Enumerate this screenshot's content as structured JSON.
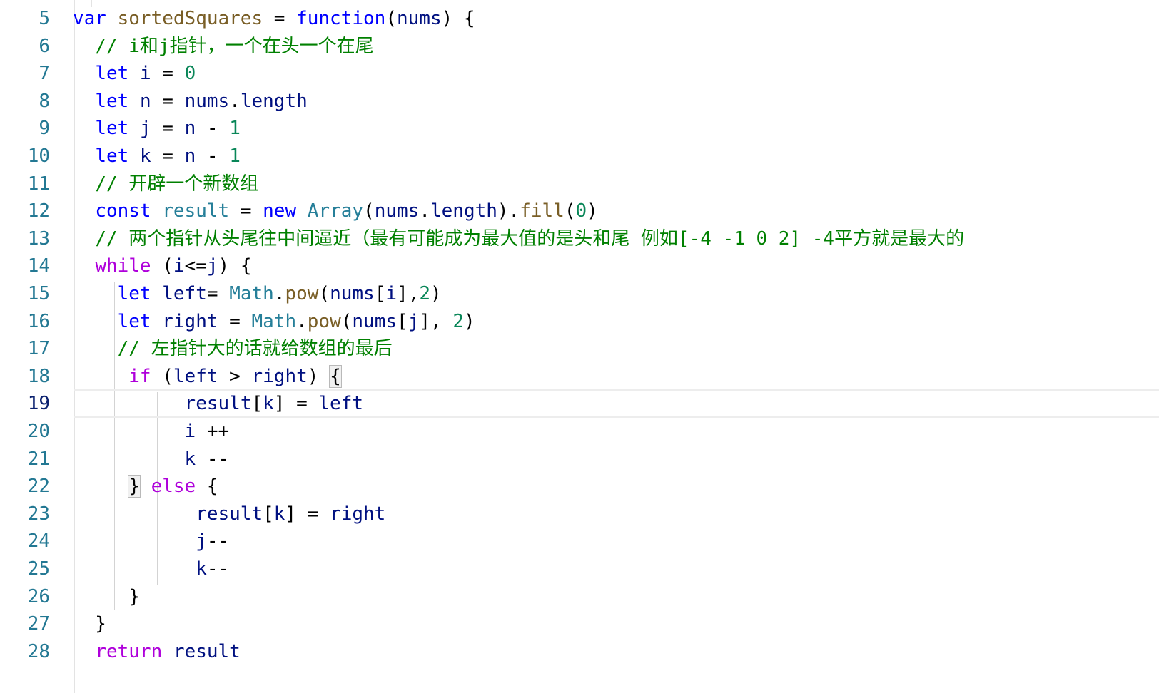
{
  "editor": {
    "current_line": "19",
    "lines": [
      {
        "n": "5",
        "tokens": [
          [
            "kw",
            "var"
          ],
          [
            "op",
            " "
          ],
          [
            "fn",
            "sortedSquares"
          ],
          [
            "op",
            " = "
          ],
          [
            "kw",
            "function"
          ],
          [
            "op",
            "("
          ],
          [
            "id",
            "nums"
          ],
          [
            "op",
            ") {"
          ]
        ]
      },
      {
        "n": "6",
        "tokens": [
          [
            "op",
            "  "
          ],
          [
            "cm",
            "// i和j指针，一个在头一个在尾"
          ]
        ]
      },
      {
        "n": "7",
        "tokens": [
          [
            "op",
            "  "
          ],
          [
            "kw",
            "let"
          ],
          [
            "op",
            " "
          ],
          [
            "id",
            "i"
          ],
          [
            "op",
            " = "
          ],
          [
            "num",
            "0"
          ]
        ]
      },
      {
        "n": "8",
        "tokens": [
          [
            "op",
            "  "
          ],
          [
            "kw",
            "let"
          ],
          [
            "op",
            " "
          ],
          [
            "id",
            "n"
          ],
          [
            "op",
            " = "
          ],
          [
            "id",
            "nums"
          ],
          [
            "op",
            "."
          ],
          [
            "id",
            "length"
          ]
        ]
      },
      {
        "n": "9",
        "tokens": [
          [
            "op",
            "  "
          ],
          [
            "kw",
            "let"
          ],
          [
            "op",
            " "
          ],
          [
            "id",
            "j"
          ],
          [
            "op",
            " = "
          ],
          [
            "id",
            "n"
          ],
          [
            "op",
            " - "
          ],
          [
            "num",
            "1"
          ]
        ]
      },
      {
        "n": "10",
        "tokens": [
          [
            "op",
            "  "
          ],
          [
            "kw",
            "let"
          ],
          [
            "op",
            " "
          ],
          [
            "id",
            "k"
          ],
          [
            "op",
            " = "
          ],
          [
            "id",
            "n"
          ],
          [
            "op",
            " - "
          ],
          [
            "num",
            "1"
          ]
        ]
      },
      {
        "n": "11",
        "tokens": [
          [
            "op",
            "  "
          ],
          [
            "cm",
            "// 开辟一个新数组"
          ]
        ]
      },
      {
        "n": "12",
        "tokens": [
          [
            "op",
            "  "
          ],
          [
            "kw",
            "const"
          ],
          [
            "op",
            " "
          ],
          [
            "cls",
            "result"
          ],
          [
            "op",
            " = "
          ],
          [
            "kw",
            "new"
          ],
          [
            "op",
            " "
          ],
          [
            "cls",
            "Array"
          ],
          [
            "op",
            "("
          ],
          [
            "id",
            "nums"
          ],
          [
            "op",
            "."
          ],
          [
            "id",
            "length"
          ],
          [
            "op",
            ")."
          ],
          [
            "fn",
            "fill"
          ],
          [
            "op",
            "("
          ],
          [
            "num",
            "0"
          ],
          [
            "op",
            ")"
          ]
        ]
      },
      {
        "n": "13",
        "tokens": [
          [
            "op",
            "  "
          ],
          [
            "cm",
            "// 两个指针从头尾往中间逼近（最有可能成为最大值的是头和尾 例如[-4 -1 0 2] -4平方就是最大的"
          ]
        ]
      },
      {
        "n": "14",
        "tokens": [
          [
            "op",
            "  "
          ],
          [
            "kw2",
            "while"
          ],
          [
            "op",
            " ("
          ],
          [
            "id",
            "i"
          ],
          [
            "op",
            "<="
          ],
          [
            "id",
            "j"
          ],
          [
            "op",
            ") {"
          ]
        ]
      },
      {
        "n": "15",
        "tokens": [
          [
            "op",
            "    "
          ],
          [
            "kw",
            "let"
          ],
          [
            "op",
            " "
          ],
          [
            "id",
            "left"
          ],
          [
            "op",
            "= "
          ],
          [
            "cls",
            "Math"
          ],
          [
            "op",
            "."
          ],
          [
            "fn",
            "pow"
          ],
          [
            "op",
            "("
          ],
          [
            "id",
            "nums"
          ],
          [
            "op",
            "["
          ],
          [
            "id",
            "i"
          ],
          [
            "op",
            "],"
          ],
          [
            "num",
            "2"
          ],
          [
            "op",
            ")"
          ]
        ]
      },
      {
        "n": "16",
        "tokens": [
          [
            "op",
            "    "
          ],
          [
            "kw",
            "let"
          ],
          [
            "op",
            " "
          ],
          [
            "id",
            "right"
          ],
          [
            "op",
            " = "
          ],
          [
            "cls",
            "Math"
          ],
          [
            "op",
            "."
          ],
          [
            "fn",
            "pow"
          ],
          [
            "op",
            "("
          ],
          [
            "id",
            "nums"
          ],
          [
            "op",
            "["
          ],
          [
            "id",
            "j"
          ],
          [
            "op",
            "], "
          ],
          [
            "num",
            "2"
          ],
          [
            "op",
            ")"
          ]
        ]
      },
      {
        "n": "17",
        "tokens": [
          [
            "op",
            "    "
          ],
          [
            "cm",
            "// 左指针大的话就给数组的最后"
          ]
        ]
      },
      {
        "n": "18",
        "tokens": [
          [
            "op",
            "     "
          ],
          [
            "kw2",
            "if"
          ],
          [
            "op",
            " ("
          ],
          [
            "id",
            "left"
          ],
          [
            "op",
            " > "
          ],
          [
            "id",
            "right"
          ],
          [
            "op",
            ") "
          ],
          [
            "bm",
            "{"
          ]
        ]
      },
      {
        "n": "19",
        "tokens": [
          [
            "op",
            "          "
          ],
          [
            "id",
            "result"
          ],
          [
            "op",
            "["
          ],
          [
            "id",
            "k"
          ],
          [
            "op",
            "] = "
          ],
          [
            "id",
            "left"
          ]
        ]
      },
      {
        "n": "20",
        "tokens": [
          [
            "op",
            "          "
          ],
          [
            "id",
            "i"
          ],
          [
            "op",
            " ++"
          ]
        ]
      },
      {
        "n": "21",
        "tokens": [
          [
            "op",
            "          "
          ],
          [
            "id",
            "k"
          ],
          [
            "op",
            " --"
          ]
        ]
      },
      {
        "n": "22",
        "tokens": [
          [
            "op",
            "     "
          ],
          [
            "bm",
            "}"
          ],
          [
            "op",
            " "
          ],
          [
            "kw2",
            "else"
          ],
          [
            "op",
            " {"
          ]
        ]
      },
      {
        "n": "23",
        "tokens": [
          [
            "op",
            "           "
          ],
          [
            "id",
            "result"
          ],
          [
            "op",
            "["
          ],
          [
            "id",
            "k"
          ],
          [
            "op",
            "] = "
          ],
          [
            "id",
            "right"
          ]
        ]
      },
      {
        "n": "24",
        "tokens": [
          [
            "op",
            "           "
          ],
          [
            "id",
            "j"
          ],
          [
            "op",
            "--"
          ]
        ]
      },
      {
        "n": "25",
        "tokens": [
          [
            "op",
            "           "
          ],
          [
            "id",
            "k"
          ],
          [
            "op",
            "--"
          ]
        ]
      },
      {
        "n": "26",
        "tokens": [
          [
            "op",
            "     }"
          ]
        ]
      },
      {
        "n": "27",
        "tokens": [
          [
            "op",
            "  }"
          ]
        ]
      },
      {
        "n": "28",
        "tokens": [
          [
            "op",
            "  "
          ],
          [
            "kw2",
            "return"
          ],
          [
            "op",
            " "
          ],
          [
            "id",
            "result"
          ]
        ]
      }
    ]
  }
}
